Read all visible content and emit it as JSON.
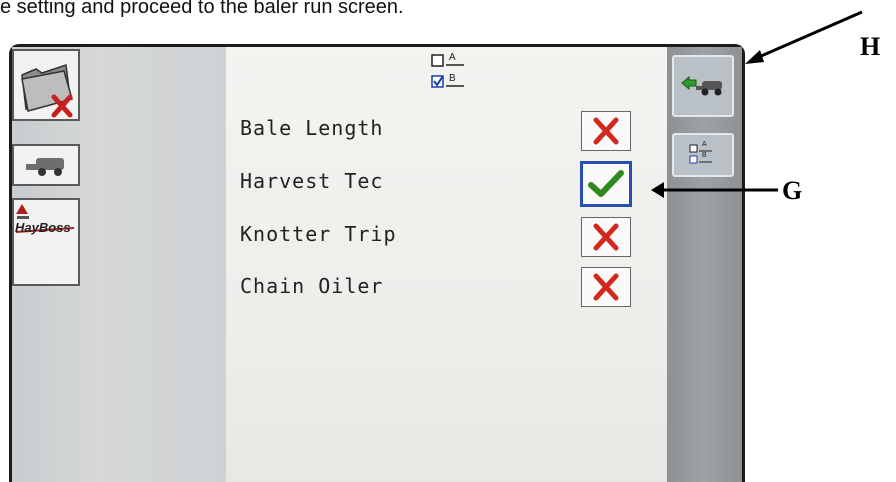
{
  "caption": "e setting and proceed to the baler run screen.",
  "profile_selector": {
    "option_a_label": "A",
    "option_b_label": "B",
    "selected": "B"
  },
  "rows": [
    {
      "label": "Bale Length",
      "state": "off"
    },
    {
      "label": "Harvest Tec",
      "state": "on"
    },
    {
      "label": "Knotter Trip",
      "state": "off"
    },
    {
      "label": "Chain Oiler",
      "state": "off"
    }
  ],
  "left_buttons": [
    {
      "icon": "folder-delete-icon"
    },
    {
      "icon": "baler-icon"
    },
    {
      "icon": "hayboss-logo-icon",
      "text": "HayBoss"
    }
  ],
  "right_buttons": [
    {
      "icon": "back-to-baler-run-icon"
    },
    {
      "icon": "profile-ab-icon",
      "option_a_label": "A",
      "option_b_label": "B"
    }
  ],
  "annotations": {
    "h_label": "H",
    "g_label": "G"
  },
  "colors": {
    "x_mark": "#d2281e",
    "check_mark": "#2f8a1e",
    "selection_border": "#2a4fb0"
  }
}
